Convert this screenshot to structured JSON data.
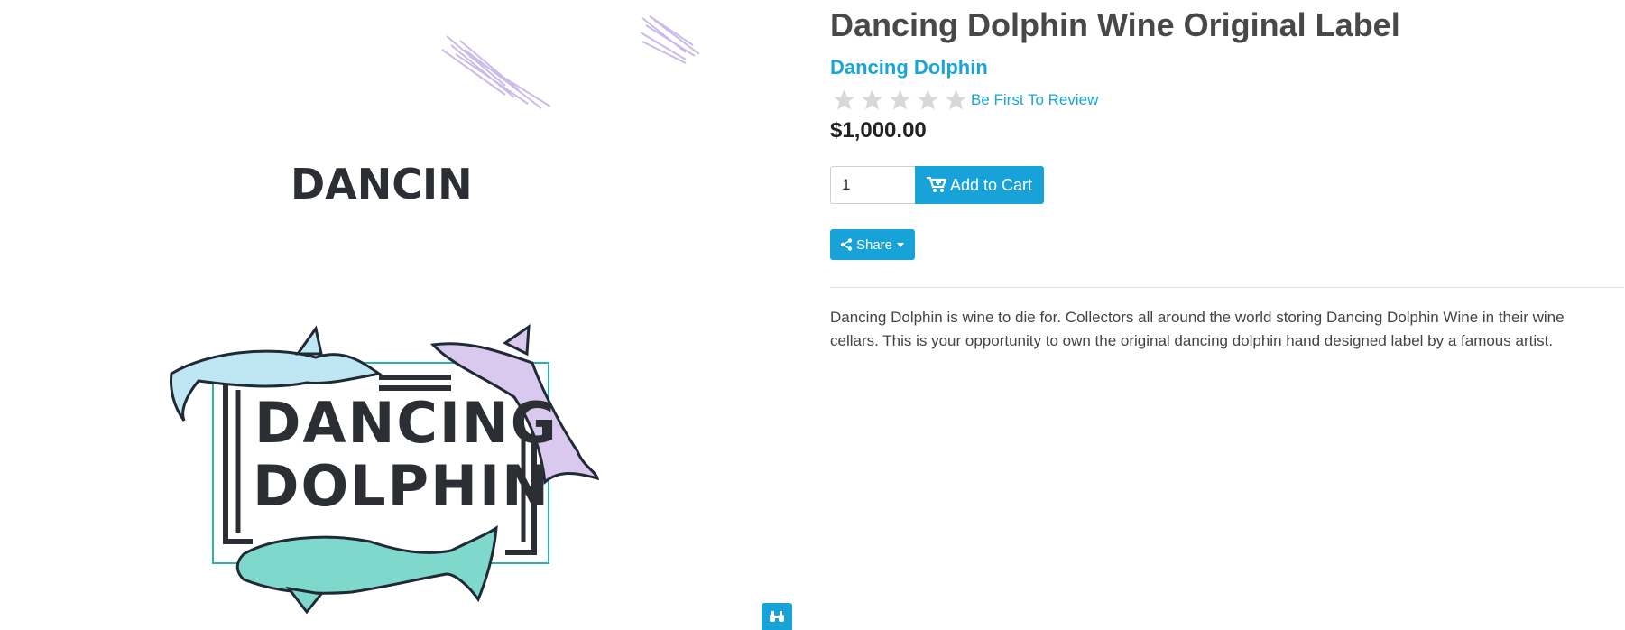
{
  "product": {
    "title": "Dancing Dolphin Wine Original Label",
    "brand": "Dancing Dolphin",
    "rating": {
      "stars": 0,
      "max": 5,
      "review_link": "Be First To Review"
    },
    "price": "$1,000.00",
    "quantity": "1",
    "add_to_cart_label": "Add to Cart",
    "share_label": "Share",
    "description": "Dancing Dolphin is wine to die for. Collectors all around the world storing Dancing Dolphin Wine in their wine cellars. This is your opportunity to own the original dancing dolphin hand designed label by a famous artist."
  },
  "image": {
    "top_text": "DANCIN",
    "logo_line1": "DANCING",
    "logo_line2": "DOLPHIN"
  },
  "icons": {
    "zoom": "binoculars-icon",
    "cart": "cart-plus-icon",
    "share": "share-icon",
    "caret": "caret-down-icon",
    "star": "star-icon"
  },
  "colors": {
    "accent": "#17a2d8",
    "link": "#19a6d6",
    "star_empty": "#d8d8d8"
  }
}
